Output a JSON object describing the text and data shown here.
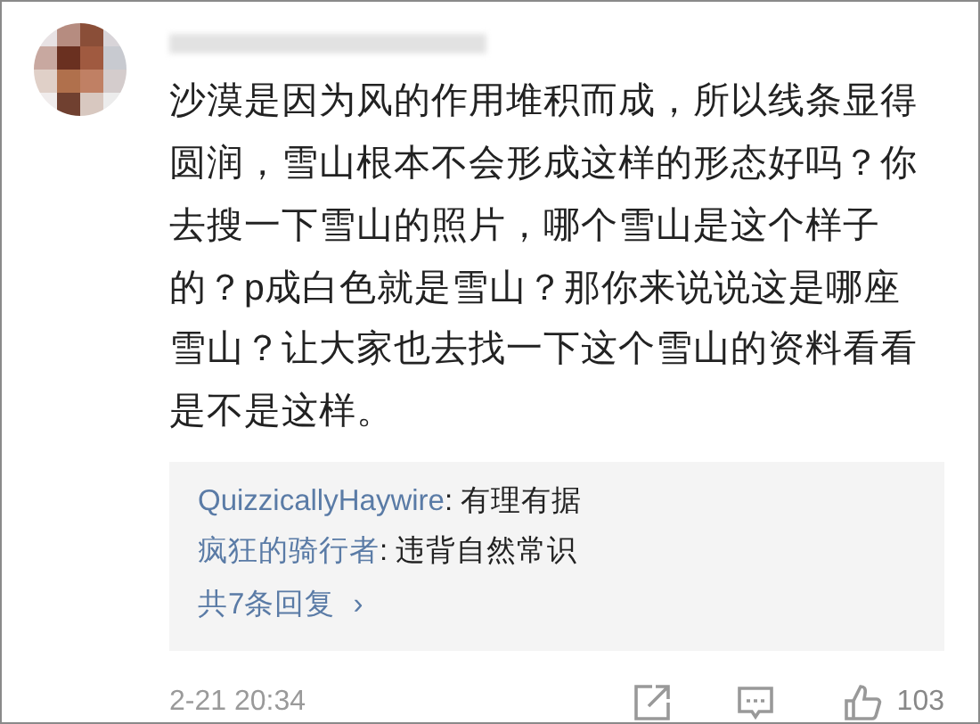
{
  "comment": {
    "text": "沙漠是因为风的作用堆积而成，所以线条显得圆润，雪山根本不会形成这样的形态好吗？你去搜一下雪山的照片，哪个雪山是这个样子的？p成白色就是雪山？那你来说说这是哪座雪山？让大家也去找一下这个雪山的资料看看是不是这样。"
  },
  "replies": [
    {
      "author": "QuizzicallyHaywire",
      "text": ": 有理有据"
    },
    {
      "author": "疯狂的骑行者",
      "text": ": 违背自然常识"
    }
  ],
  "more_replies": "共7条回复",
  "more_arrow": "›",
  "footer": {
    "time": "2-21 20:34",
    "likes": "103"
  }
}
